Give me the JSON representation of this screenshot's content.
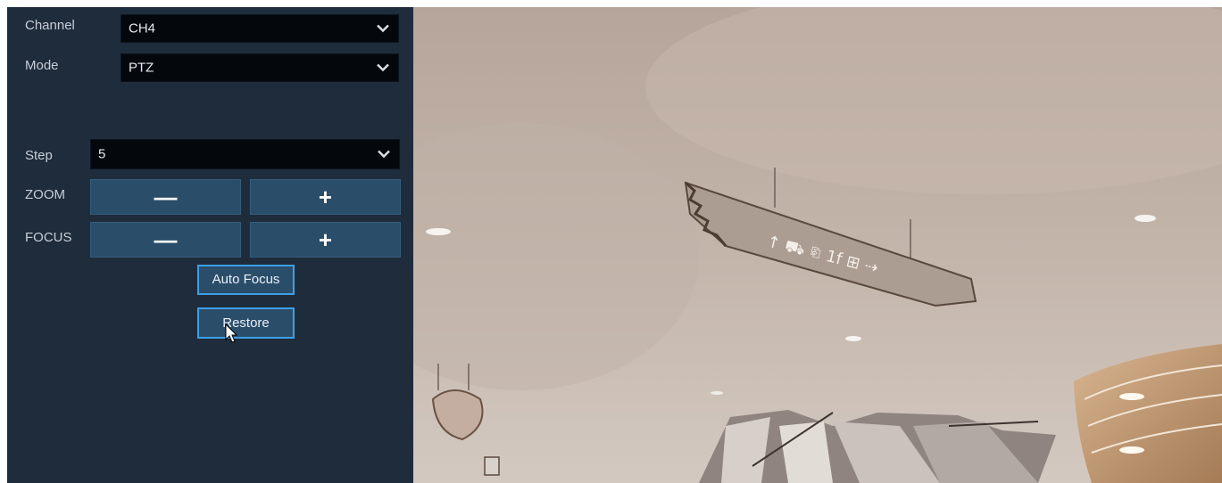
{
  "panel": {
    "channel": {
      "label": "Channel",
      "value": "CH4",
      "chevron": "chevron-down-icon"
    },
    "mode": {
      "label": "Mode",
      "value": "PTZ",
      "chevron": "chevron-down-icon"
    },
    "step": {
      "label": "Step",
      "value": "5",
      "chevron": "chevron-down-icon"
    },
    "zoom": {
      "label": "ZOOM",
      "minus": "—",
      "plus": "+"
    },
    "focus": {
      "label": "FOCUS",
      "minus": "—",
      "plus": "+"
    },
    "auto_focus_label": "Auto Focus",
    "restore_label": "Restore"
  },
  "video": {
    "sign_text": "↑ ⛟ ⎘ 1f ⊞ ⇢"
  },
  "colors": {
    "panel_bg": "#1f2c3c",
    "button_bg": "#2a4d6a",
    "button_border": "#3d9fe6",
    "select_bg": "#04070c"
  }
}
